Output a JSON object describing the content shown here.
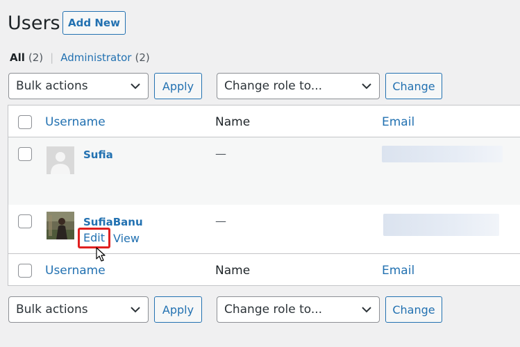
{
  "header": {
    "title": "Users",
    "add_new_label": "Add New"
  },
  "filters": {
    "all_label": "All",
    "all_count": "(2)",
    "separator": "|",
    "admin_label": "Administrator",
    "admin_count": "(2)"
  },
  "top_actions": {
    "bulk_selected": "Bulk actions",
    "apply_label": "Apply",
    "role_selected": "Change role to...",
    "change_label": "Change"
  },
  "bottom_actions": {
    "bulk_selected": "Bulk actions",
    "apply_label": "Apply",
    "role_selected": "Change role to...",
    "change_label": "Change"
  },
  "table": {
    "columns": [
      "Username",
      "Name",
      "Email"
    ],
    "rows": [
      {
        "username": "Sufia",
        "name": "—",
        "email_redacted": true
      },
      {
        "username": "SufiaBanu",
        "name": "—",
        "email_redacted": true,
        "actions": [
          "Edit",
          "View"
        ]
      }
    ]
  },
  "colors": {
    "accent": "#2271b1",
    "highlight": "#e02020",
    "background": "#f0f0f1"
  }
}
